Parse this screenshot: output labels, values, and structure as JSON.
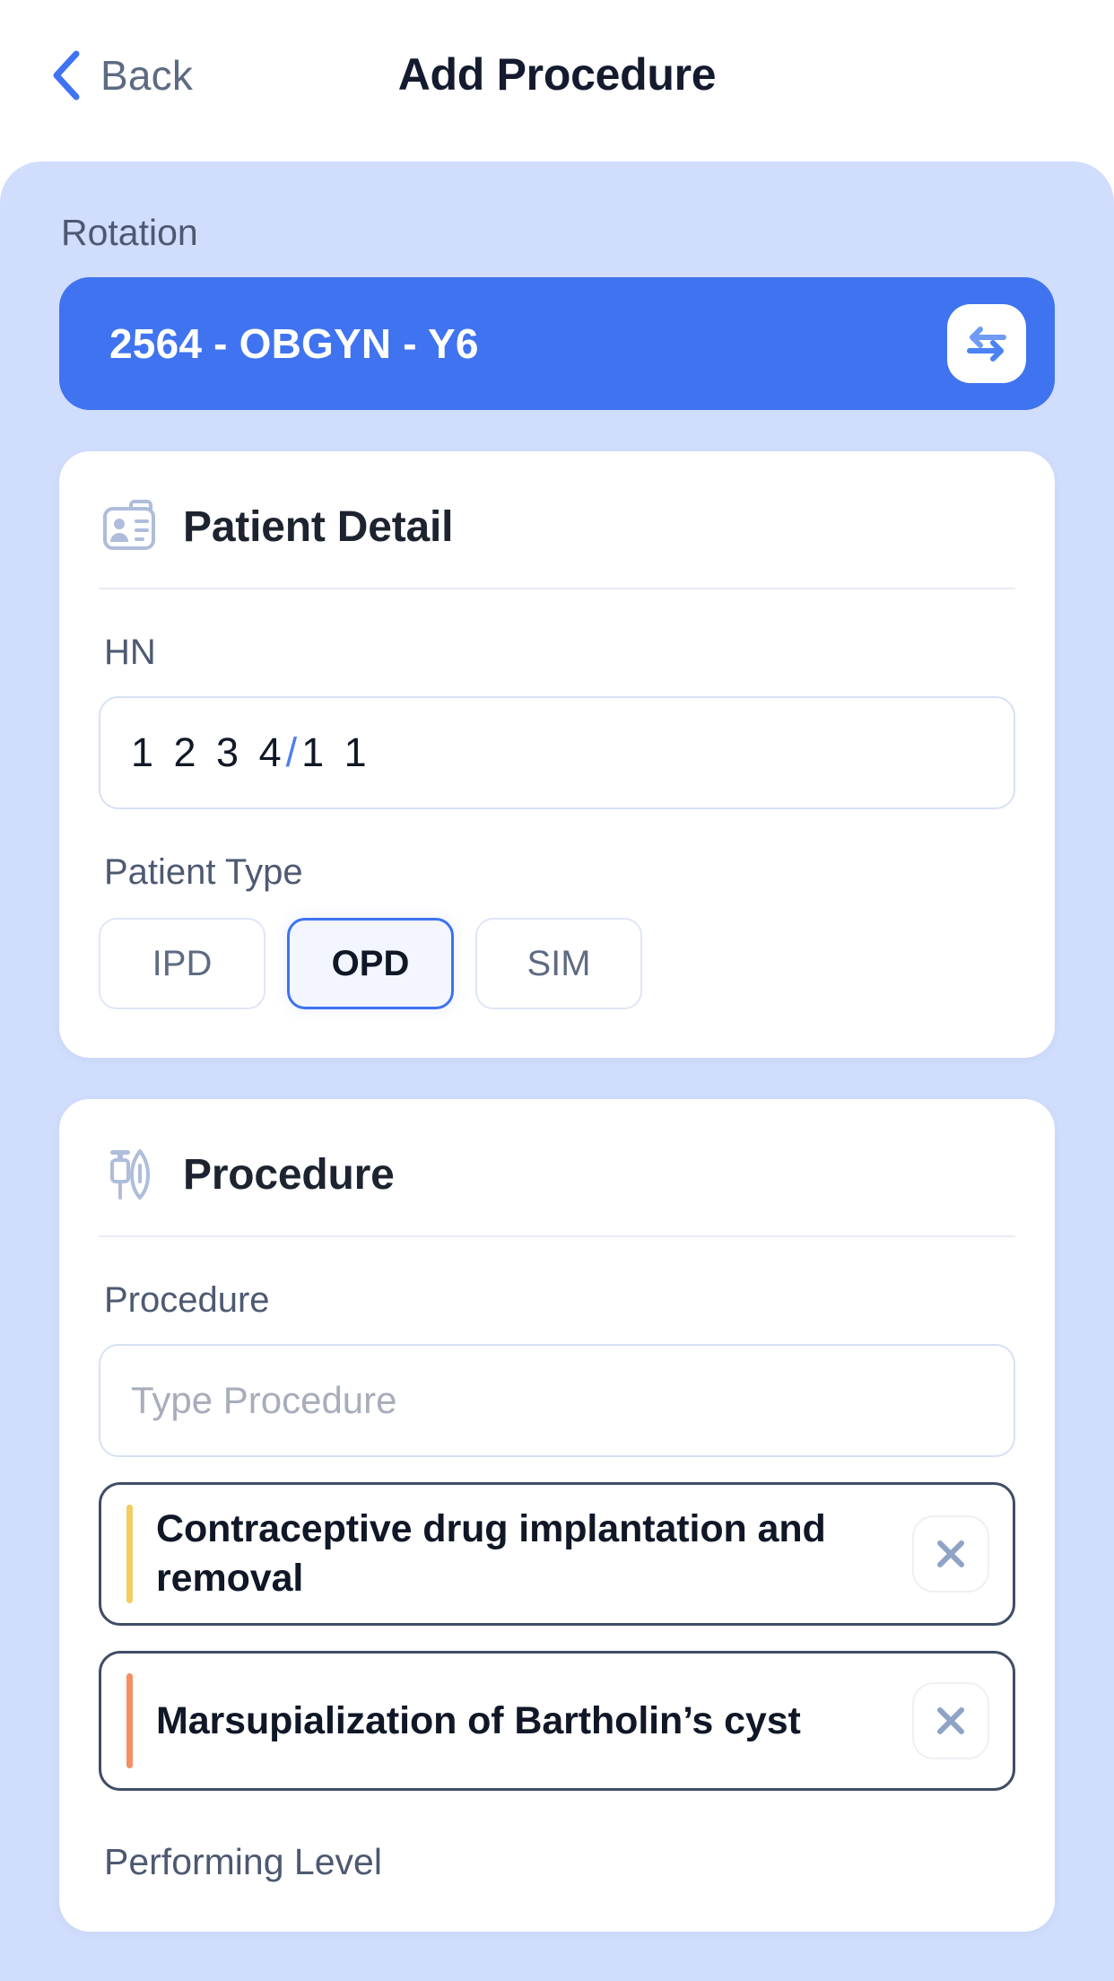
{
  "header": {
    "back_label": "Back",
    "back_icon": "chevron-left-icon",
    "title": "Add Procedure"
  },
  "rotation": {
    "label": "Rotation",
    "value": "2564 - OBGYN - Y6",
    "swap_icon": "swap-horizontal-icon"
  },
  "patient_detail": {
    "icon": "id-card-icon",
    "title": "Patient Detail",
    "hn": {
      "label": "HN",
      "value_prefix": "1 2 3 4",
      "value_separator": "/",
      "value_suffix": "1 1"
    },
    "patient_type": {
      "label": "Patient Type",
      "options": [
        {
          "label": "IPD",
          "selected": false
        },
        {
          "label": "OPD",
          "selected": true
        },
        {
          "label": "SIM",
          "selected": false
        }
      ]
    }
  },
  "procedure": {
    "icon": "syringe-scalpel-icon",
    "title": "Procedure",
    "field_label": "Procedure",
    "input_placeholder": "Type Procedure",
    "input_value": "",
    "selected": [
      {
        "name": "Contraceptive drug implantation and removal",
        "accent": "#f5cb63",
        "remove_icon": "close-icon"
      },
      {
        "name": "Marsupialization of Bartholin’s cyst",
        "accent": "#f58f63",
        "remove_icon": "close-icon"
      }
    ],
    "performing_level_label": "Performing Level"
  },
  "colors": {
    "accent_blue": "#3f73f0",
    "sheet_bg": "#d0ddfc",
    "card_bg": "#ffffff",
    "chip_border": "#414d66",
    "text_dark": "#101726",
    "text_muted": "#4d5971"
  }
}
